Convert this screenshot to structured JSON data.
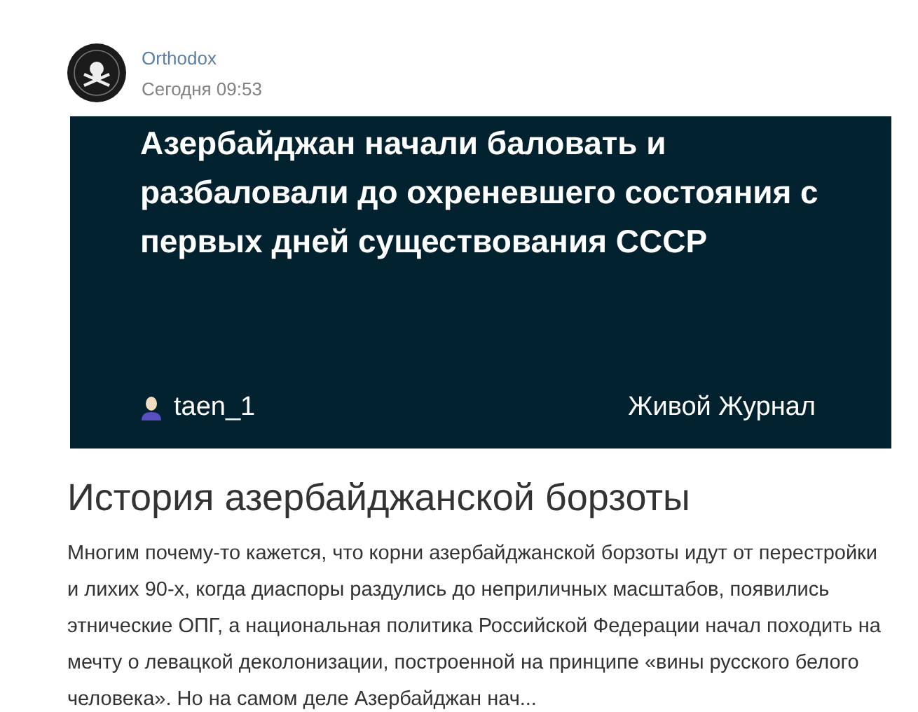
{
  "post": {
    "author": "Orthodox",
    "time": "Сегодня 09:53"
  },
  "preview": {
    "headline": "Азербайджан начали баловать и разбаловали до охреневшего состояния с первых дней существования СССР",
    "user": "taen_1",
    "source": "Живой Журнал"
  },
  "article": {
    "title": "История азербайджанской борзоты",
    "excerpt": "Многим почему-то кажется, что корни азербайджанской борзоты идут от перестройки и лихих 90-х, когда диаспоры раздулись до неприличных масштабов, появились этнические ОПГ, а национальная политика Российской Федерации начал походить на мечту о левацкой деколонизации, построенной на принципе «вины русского белого человека». Но на самом деле Азербайджан нач..."
  }
}
